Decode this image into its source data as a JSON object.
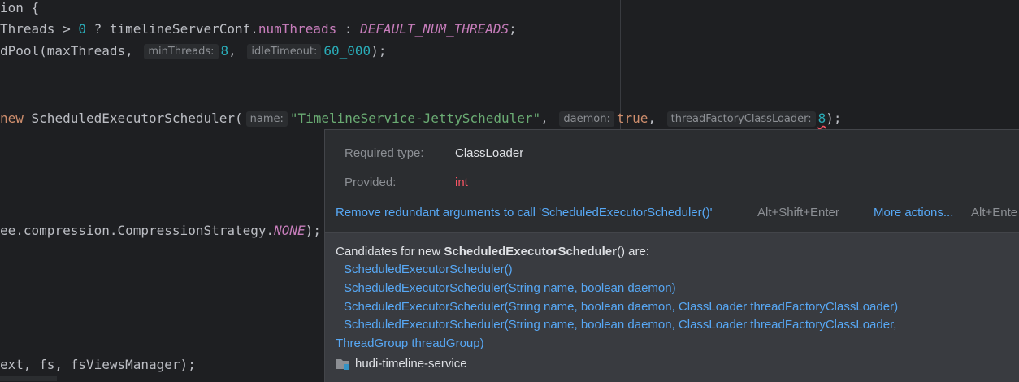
{
  "editor": {
    "line1": {
      "text": "ion {"
    },
    "line2": {
      "part1": "Threads > ",
      "num0": "0",
      "part2": " ? timelineServerConf.",
      "field": "numThreads",
      "part3": " : ",
      "const": "DEFAULT_NUM_THREADS",
      "part4": ";"
    },
    "line3": {
      "part1": "dPool(maxThreads, ",
      "hint1": "minThreads:",
      "val1": "8",
      "sep1": ", ",
      "hint2": "idleTimeout:",
      "val2": "60_000",
      "part2": ");"
    },
    "line4": {
      "kw": "new",
      "part1": " ScheduledExecutorScheduler(",
      "hint1": "name:",
      "str1": "\"TimelineService-JettyScheduler\"",
      "sep1": ", ",
      "hint2": "daemon:",
      "kw2": "true",
      "sep2": ", ",
      "hint3": "threadFactoryClassLoader:",
      "val3": "8",
      "part2": ");"
    },
    "line5": {
      "part1": "ee.compression.CompressionStrategy.",
      "const": "NONE",
      "part2": ");"
    },
    "line6": {
      "text": "ext, fs, fsViewsManager);"
    }
  },
  "popup": {
    "required_label": "Required type:",
    "required_value": "ClassLoader",
    "provided_label": "Provided:",
    "provided_value": "int",
    "fix_action": "Remove redundant arguments to call 'ScheduledExecutorScheduler()'",
    "fix_shortcut": "Alt+Shift+Enter",
    "more_actions": "More actions...",
    "more_shortcut": "Alt+Ente",
    "candidates_prefix": "Candidates for new ",
    "candidates_class": "ScheduledExecutorScheduler",
    "candidates_suffix": "() are:",
    "candidates": [
      "ScheduledExecutorScheduler()",
      "ScheduledExecutorScheduler(String name, boolean daemon)",
      "ScheduledExecutorScheduler(String name, boolean daemon, ClassLoader threadFactoryClassLoader)",
      "ScheduledExecutorScheduler(String name, boolean daemon, ClassLoader threadFactoryClassLoader,"
    ],
    "candidate_wrap": "ThreadGroup threadGroup)",
    "module_name": "hudi-timeline-service",
    "module_icon": "module-folder-icon"
  },
  "colors": {
    "editor_bg": "#1e1f22",
    "popup_bg": "#2b2d30",
    "link": "#57a8f5",
    "error": "#f75464"
  }
}
